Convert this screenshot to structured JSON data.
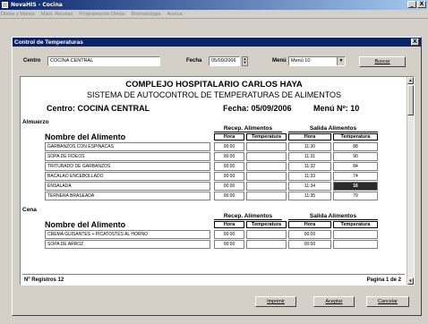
{
  "app": {
    "title": "NovaHIS - Cocina",
    "minimize": "_",
    "close": "X"
  },
  "menu": [
    "Dietas y Menús",
    "Mant. Recetas",
    "Programación Dietas",
    "Bromatología",
    "Acerca"
  ],
  "dialog": {
    "title": "Control de Temperaturas",
    "close": "X",
    "filter": {
      "centro_label": "Centro",
      "centro_value": "COCINA CENTRAL",
      "fecha_label": "Fecha",
      "fecha_value": "05/09/2006",
      "menu_label": "Menú",
      "menu_value": "Menú 10",
      "buscar_label": "Buscar"
    },
    "report": {
      "title": "COMPLEJO HOSPITALARIO CARLOS HAYA",
      "subtitle": "SISTEMA DE AUTOCONTROL DE TEMPERATURAS DE ALIMENTOS",
      "centro": "Centro:  COCINA CENTRAL",
      "fecha": "Fecha: 05/09/2006",
      "menu": "Menú Nº: 10",
      "nombre_header": "Nombre del Alimento",
      "recep_header": "Recep. Alimentos",
      "salida_header": "Salida Alimentos",
      "hora_header": "Hora",
      "temp_header": "Temperatura",
      "sections": [
        {
          "label": "Almuerzo",
          "rows": [
            {
              "name": "GARBANZOS CON ESPINACAS",
              "rh": "00:00",
              "rt": "",
              "sh": "11:30",
              "st": "88"
            },
            {
              "name": "SOPA DE FIDEOS",
              "rh": "00:00",
              "rt": "",
              "sh": "11:31",
              "st": "90"
            },
            {
              "name": "TRITURADO DE GARBANZOS",
              "rh": "00:00",
              "rt": "",
              "sh": "11:32",
              "st": "84"
            },
            {
              "name": "BACALAO ENCEBOLLADO",
              "rh": "00:00",
              "rt": "",
              "sh": "11:33",
              "st": "74"
            },
            {
              "name": "ENSALADA",
              "rh": "00:00",
              "rt": "",
              "sh": "11:34",
              "st": "16"
            },
            {
              "name": "TERNERA BRASEADA",
              "rh": "00:00",
              "rt": "",
              "sh": "11:35",
              "st": "79"
            }
          ]
        },
        {
          "label": "Cena",
          "rows": [
            {
              "name": "CREMA GUISANTES + PICATOSTES AL HORNO",
              "rh": "00:00",
              "rt": "",
              "sh": "00:00",
              "st": ""
            },
            {
              "name": "SOPA DE ARROZ",
              "rh": "00:00",
              "rt": "",
              "sh": "00:00",
              "st": ""
            }
          ]
        }
      ],
      "registros": "Nº Registros 12",
      "pagina": "Pagina 1 de 2"
    },
    "buttons": {
      "imprimir": "Imprimir",
      "aceptar": "Aceptar",
      "cancelar": "Cancelar"
    }
  }
}
